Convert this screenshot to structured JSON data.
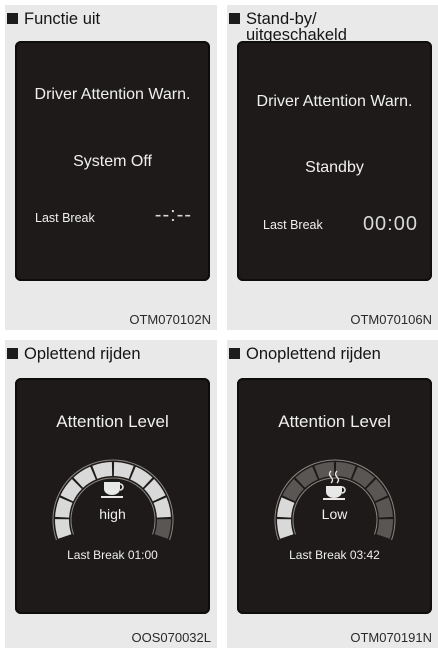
{
  "panels": [
    {
      "heading": "Functie uit",
      "heading_line2": "",
      "screen_title": "Driver Attention Warn.",
      "status": "System Off",
      "last_break_label": "Last Break",
      "last_break_value": "--:--",
      "code": "OTM070102N"
    },
    {
      "heading": "Stand-by/",
      "heading_line2": "uitgeschakeld",
      "screen_title": "Driver Attention Warn.",
      "status": "Standby",
      "last_break_label": "Last Break",
      "last_break_value": "00:00",
      "code": "OTM070106N"
    },
    {
      "heading": "Oplettend rijden",
      "screen_title": "Attention Level",
      "icon": "coffee-cup-icon",
      "level": "high",
      "level_fraction": 0.85,
      "last_break": "Last Break 01:00",
      "code": "OOS070032L"
    },
    {
      "heading": "Onoplettend rijden",
      "screen_title": "Attention Level",
      "icon": "steaming-coffee-cup-icon",
      "level": "Low",
      "level_fraction": 0.15,
      "last_break": "Last Break 03:42",
      "code": "OTM070191N"
    }
  ],
  "colors": {
    "panel_bg": "#e9e9e9",
    "screen_bg": "#1d1a19",
    "screen_text": "#f0f0f0",
    "gauge_lit": "#d9d9d9",
    "gauge_dim": "#5a5654"
  }
}
